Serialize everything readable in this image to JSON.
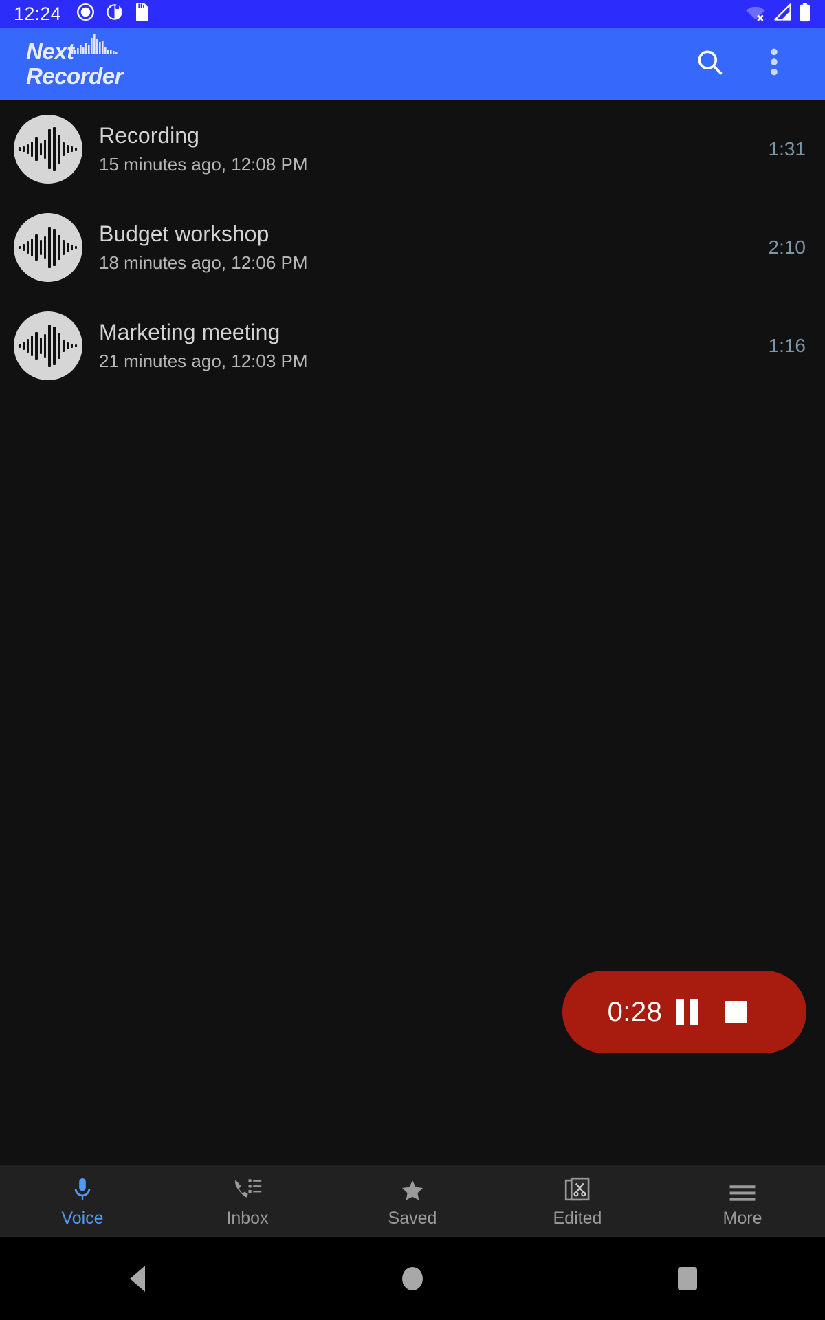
{
  "status_bar": {
    "time": "12:24",
    "left_icons": [
      "record-circle-icon",
      "brightness-contrast-icon",
      "sd-card-icon"
    ],
    "right_icons": [
      "wifi-off-icon",
      "cell-signal-icon",
      "battery-full-icon"
    ]
  },
  "app_bar": {
    "title": "Next\nRecorder",
    "logo_icon": "waveform-logo-icon",
    "search_label": "search-icon",
    "overflow_label": "more-options-icon",
    "background_color": "#3568fb"
  },
  "recordings": [
    {
      "title": "Recording",
      "subtitle": "15 minutes ago, 12:08 PM",
      "duration": "1:31",
      "avatar_icon": "waveform-avatar-icon"
    },
    {
      "title": "Budget workshop",
      "subtitle": "18 minutes ago, 12:06 PM",
      "duration": "2:10",
      "avatar_icon": "waveform-avatar-icon"
    },
    {
      "title": "Marketing meeting",
      "subtitle": "21 minutes ago, 12:03 PM",
      "duration": "1:16",
      "avatar_icon": "waveform-avatar-icon"
    }
  ],
  "recorder": {
    "elapsed": "0:28",
    "pause_label": "pause-icon",
    "stop_label": "stop-icon",
    "color": "#a81c10"
  },
  "tabs": [
    {
      "label": "Voice",
      "icon": "microphone-icon",
      "active": true
    },
    {
      "label": "Inbox",
      "icon": "phone-list-icon",
      "active": false
    },
    {
      "label": "Saved",
      "icon": "star-icon",
      "active": false
    },
    {
      "label": "Edited",
      "icon": "document-scissors-icon",
      "active": false
    },
    {
      "label": "More",
      "icon": "hamburger-menu-icon",
      "active": false
    }
  ],
  "nav_bar": {
    "back": "back-icon",
    "home": "home-icon",
    "recents": "recents-icon"
  },
  "colors": {
    "accent_blue": "#4e9cf5",
    "status_blue": "#2d2dfb",
    "duration_text": "#7d95a8",
    "background": "#111111"
  }
}
